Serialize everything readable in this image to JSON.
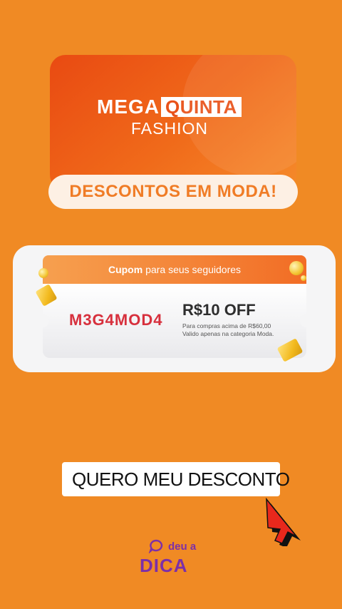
{
  "banner": {
    "logo_mega": "MEGA",
    "logo_quinta": "QUINTA",
    "logo_fashion": "FASHION",
    "pill_text": "DESCONTOS EM MODA!"
  },
  "coupon": {
    "header_bold": "Cupom",
    "header_text": "para seus seguidores",
    "code": "M3G4MOD4",
    "offer_title": "R$10 OFF",
    "offer_line1": "Para compras acima de R$60,00",
    "offer_line2": "Valido apenas na categoria Moda."
  },
  "cta": {
    "label": "QUERO MEU DESCONTO",
    "icon": "link-icon"
  },
  "brand": {
    "top": "deu a",
    "bottom": "DICA",
    "icon": "speech-bubble-icon"
  },
  "colors": {
    "background": "#f08a24",
    "banner_red": "#e94a12",
    "pill_text": "#f07c26",
    "code_red": "#d7303d",
    "brand_purple": "#7d2fa8",
    "cursor_red": "#e8281c"
  }
}
